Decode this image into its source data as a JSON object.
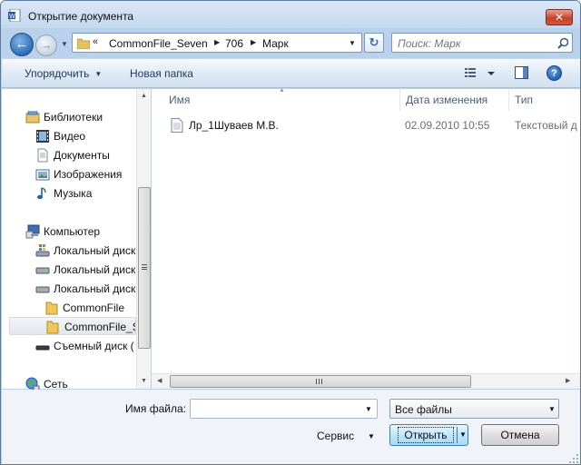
{
  "window": {
    "title": "Открытие документа",
    "close_glyph": "✕"
  },
  "address": {
    "overflow_glyph": "«",
    "crumbs": [
      "CommonFile_Seven",
      "706",
      "Марк"
    ],
    "refresh_glyph": "↻"
  },
  "search": {
    "placeholder": "Поиск: Марк"
  },
  "commandbar": {
    "organize": "Упорядочить",
    "new_folder": "Новая папка",
    "help_glyph": "?"
  },
  "nav": {
    "items": [
      {
        "label": "Библиотеки",
        "icon": "libraries-icon"
      },
      {
        "label": "Видео",
        "icon": "video-icon"
      },
      {
        "label": "Документы",
        "icon": "documents-icon"
      },
      {
        "label": "Изображения",
        "icon": "pictures-icon"
      },
      {
        "label": "Музыка",
        "icon": "music-icon"
      },
      {
        "label": "Компьютер",
        "icon": "computer-icon"
      },
      {
        "label": "Локальный диск",
        "icon": "system-drive-icon"
      },
      {
        "label": "Локальный диск",
        "icon": "drive-icon"
      },
      {
        "label": "Локальный диск",
        "icon": "drive-icon"
      },
      {
        "label": "CommonFile",
        "icon": "folder-icon"
      },
      {
        "label": "CommonFile_S",
        "icon": "folder-icon"
      },
      {
        "label": "Съемный диск (",
        "icon": "removable-drive-icon"
      },
      {
        "label": "Сеть",
        "icon": "network-icon"
      }
    ]
  },
  "files": {
    "columns": [
      "Имя",
      "Дата изменения",
      "Тип"
    ],
    "rows": [
      {
        "name": "Лр_1Шуваев М.В.",
        "date": "02.09.2010 10:55",
        "type": "Текстовый д",
        "icon": "text-document-icon"
      }
    ]
  },
  "bottom": {
    "filename_label": "Имя файла:",
    "filename_value": "",
    "filter_value": "Все файлы",
    "tools": "Сервис",
    "open": "Открыть",
    "cancel": "Отмена"
  },
  "colors": {
    "window_frame": "#b9d1ea",
    "accent": "#2b6fb8",
    "close": "#c6432d"
  }
}
